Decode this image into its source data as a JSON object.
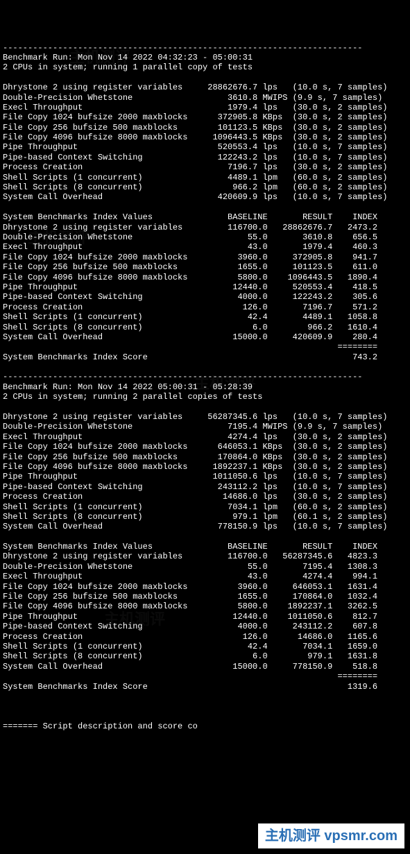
{
  "dashes": "------------------------------------------------------------------------",
  "run1": {
    "header": "Benchmark Run: Mon Nov 14 2022 04:32:23 - 05:00:31",
    "sub": "2 CPUs in system; running 1 parallel copy of tests",
    "tests": [
      {
        "name": "Dhrystone 2 using register variables",
        "val": "28862676.7",
        "unit": "lps",
        "t": "(10.0 s, 7 samples)"
      },
      {
        "name": "Double-Precision Whetstone",
        "val": "3610.8",
        "unit": "MWIPS",
        "t": "(9.9 s, 7 samples)"
      },
      {
        "name": "Execl Throughput",
        "val": "1979.4",
        "unit": "lps",
        "t": "(30.0 s, 2 samples)"
      },
      {
        "name": "File Copy 1024 bufsize 2000 maxblocks",
        "val": "372905.8",
        "unit": "KBps",
        "t": "(30.0 s, 2 samples)"
      },
      {
        "name": "File Copy 256 bufsize 500 maxblocks",
        "val": "101123.5",
        "unit": "KBps",
        "t": "(30.0 s, 2 samples)"
      },
      {
        "name": "File Copy 4096 bufsize 8000 maxblocks",
        "val": "1096443.5",
        "unit": "KBps",
        "t": "(30.0 s, 2 samples)"
      },
      {
        "name": "Pipe Throughput",
        "val": "520553.4",
        "unit": "lps",
        "t": "(10.0 s, 7 samples)"
      },
      {
        "name": "Pipe-based Context Switching",
        "val": "122243.2",
        "unit": "lps",
        "t": "(10.0 s, 7 samples)"
      },
      {
        "name": "Process Creation",
        "val": "7196.7",
        "unit": "lps",
        "t": "(30.0 s, 2 samples)"
      },
      {
        "name": "Shell Scripts (1 concurrent)",
        "val": "4489.1",
        "unit": "lpm",
        "t": "(60.0 s, 2 samples)"
      },
      {
        "name": "Shell Scripts (8 concurrent)",
        "val": "966.2",
        "unit": "lpm",
        "t": "(60.0 s, 2 samples)"
      },
      {
        "name": "System Call Overhead",
        "val": "420609.9",
        "unit": "lps",
        "t": "(10.0 s, 7 samples)"
      }
    ],
    "index_header": "System Benchmarks Index Values               BASELINE       RESULT    INDEX",
    "indices": [
      {
        "name": "Dhrystone 2 using register variables",
        "base": "116700.0",
        "res": "28862676.7",
        "idx": "2473.2"
      },
      {
        "name": "Double-Precision Whetstone",
        "base": "55.0",
        "res": "3610.8",
        "idx": "656.5"
      },
      {
        "name": "Execl Throughput",
        "base": "43.0",
        "res": "1979.4",
        "idx": "460.3"
      },
      {
        "name": "File Copy 1024 bufsize 2000 maxblocks",
        "base": "3960.0",
        "res": "372905.8",
        "idx": "941.7"
      },
      {
        "name": "File Copy 256 bufsize 500 maxblocks",
        "base": "1655.0",
        "res": "101123.5",
        "idx": "611.0"
      },
      {
        "name": "File Copy 4096 bufsize 8000 maxblocks",
        "base": "5800.0",
        "res": "1096443.5",
        "idx": "1890.4"
      },
      {
        "name": "Pipe Throughput",
        "base": "12440.0",
        "res": "520553.4",
        "idx": "418.5"
      },
      {
        "name": "Pipe-based Context Switching",
        "base": "4000.0",
        "res": "122243.2",
        "idx": "305.6"
      },
      {
        "name": "Process Creation",
        "base": "126.0",
        "res": "7196.7",
        "idx": "571.2"
      },
      {
        "name": "Shell Scripts (1 concurrent)",
        "base": "42.4",
        "res": "4489.1",
        "idx": "1058.8"
      },
      {
        "name": "Shell Scripts (8 concurrent)",
        "base": "6.0",
        "res": "966.2",
        "idx": "1610.4"
      },
      {
        "name": "System Call Overhead",
        "base": "15000.0",
        "res": "420609.9",
        "idx": "280.4"
      }
    ],
    "eqline": "                                                                   ========",
    "score_label": "System Benchmarks Index Score",
    "score": "743.2"
  },
  "run2": {
    "header": "Benchmark Run: Mon Nov 14 2022 05:00:31 - 05:28:39",
    "sub": "2 CPUs in system; running 2 parallel copies of tests",
    "tests": [
      {
        "name": "Dhrystone 2 using register variables",
        "val": "56287345.6",
        "unit": "lps",
        "t": "(10.0 s, 7 samples)"
      },
      {
        "name": "Double-Precision Whetstone",
        "val": "7195.4",
        "unit": "MWIPS",
        "t": "(9.9 s, 7 samples)"
      },
      {
        "name": "Execl Throughput",
        "val": "4274.4",
        "unit": "lps",
        "t": "(30.0 s, 2 samples)"
      },
      {
        "name": "File Copy 1024 bufsize 2000 maxblocks",
        "val": "646053.1",
        "unit": "KBps",
        "t": "(30.0 s, 2 samples)"
      },
      {
        "name": "File Copy 256 bufsize 500 maxblocks",
        "val": "170864.0",
        "unit": "KBps",
        "t": "(30.0 s, 2 samples)"
      },
      {
        "name": "File Copy 4096 bufsize 8000 maxblocks",
        "val": "1892237.1",
        "unit": "KBps",
        "t": "(30.0 s, 2 samples)"
      },
      {
        "name": "Pipe Throughput",
        "val": "1011050.6",
        "unit": "lps",
        "t": "(10.0 s, 7 samples)"
      },
      {
        "name": "Pipe-based Context Switching",
        "val": "243112.2",
        "unit": "lps",
        "t": "(10.0 s, 7 samples)"
      },
      {
        "name": "Process Creation",
        "val": "14686.0",
        "unit": "lps",
        "t": "(30.0 s, 2 samples)"
      },
      {
        "name": "Shell Scripts (1 concurrent)",
        "val": "7034.1",
        "unit": "lpm",
        "t": "(60.0 s, 2 samples)"
      },
      {
        "name": "Shell Scripts (8 concurrent)",
        "val": "979.1",
        "unit": "lpm",
        "t": "(60.1 s, 2 samples)"
      },
      {
        "name": "System Call Overhead",
        "val": "778150.9",
        "unit": "lps",
        "t": "(10.0 s, 7 samples)"
      }
    ],
    "index_header": "System Benchmarks Index Values               BASELINE       RESULT    INDEX",
    "indices": [
      {
        "name": "Dhrystone 2 using register variables",
        "base": "116700.0",
        "res": "56287345.6",
        "idx": "4823.3"
      },
      {
        "name": "Double-Precision Whetstone",
        "base": "55.0",
        "res": "7195.4",
        "idx": "1308.3"
      },
      {
        "name": "Execl Throughput",
        "base": "43.0",
        "res": "4274.4",
        "idx": "994.1"
      },
      {
        "name": "File Copy 1024 bufsize 2000 maxblocks",
        "base": "3960.0",
        "res": "646053.1",
        "idx": "1631.4"
      },
      {
        "name": "File Copy 256 bufsize 500 maxblocks",
        "base": "1655.0",
        "res": "170864.0",
        "idx": "1032.4"
      },
      {
        "name": "File Copy 4096 bufsize 8000 maxblocks",
        "base": "5800.0",
        "res": "1892237.1",
        "idx": "3262.5"
      },
      {
        "name": "Pipe Throughput",
        "base": "12440.0",
        "res": "1011050.6",
        "idx": "812.7"
      },
      {
        "name": "Pipe-based Context Switching",
        "base": "4000.0",
        "res": "243112.2",
        "idx": "607.8"
      },
      {
        "name": "Process Creation",
        "base": "126.0",
        "res": "14686.0",
        "idx": "1165.6"
      },
      {
        "name": "Shell Scripts (1 concurrent)",
        "base": "42.4",
        "res": "7034.1",
        "idx": "1659.0"
      },
      {
        "name": "Shell Scripts (8 concurrent)",
        "base": "6.0",
        "res": "979.1",
        "idx": "1631.8"
      },
      {
        "name": "System Call Overhead",
        "base": "15000.0",
        "res": "778150.9",
        "idx": "518.8"
      }
    ],
    "eqline": "                                                                   ========",
    "score_label": "System Benchmarks Index Score",
    "score": "1319.6"
  },
  "footer": "======= Script description and score co",
  "watermark": "主机测评 vpsmr.com",
  "faint_watermark": "主机测评"
}
